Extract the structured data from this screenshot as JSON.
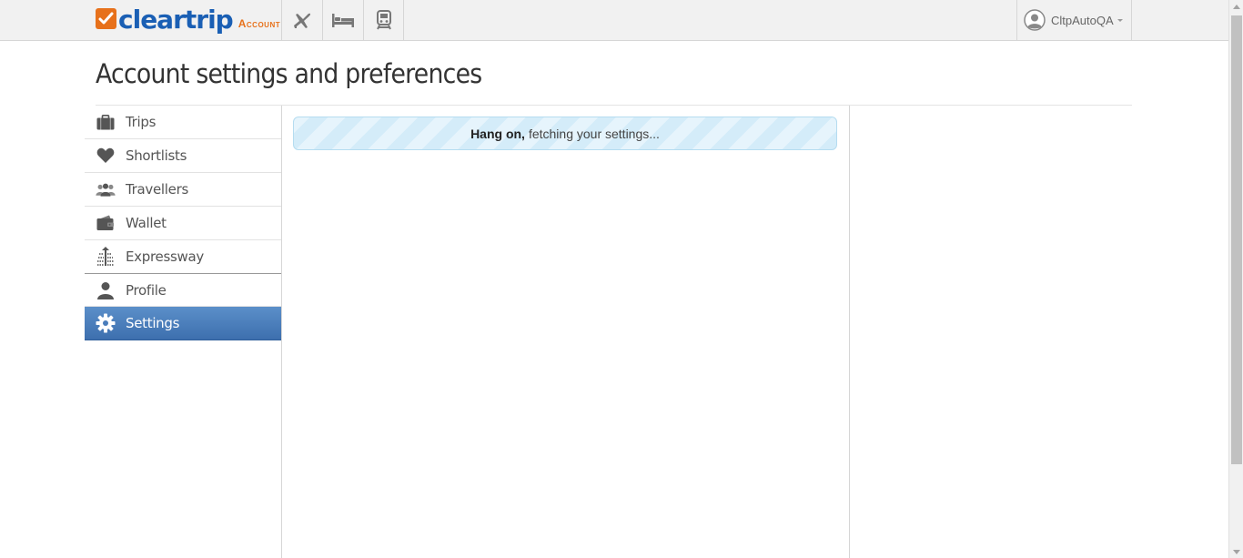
{
  "header": {
    "brand": "cleartrip",
    "brand_sub": "Account",
    "nav": [
      {
        "icon": "airplane-icon"
      },
      {
        "icon": "bed-icon"
      },
      {
        "icon": "train-icon"
      }
    ],
    "user_name": "CltpAutoQA"
  },
  "page": {
    "title": "Account settings and preferences"
  },
  "sidebar": {
    "items": [
      {
        "label": "Trips",
        "icon": "briefcase-icon"
      },
      {
        "label": "Shortlists",
        "icon": "heart-icon"
      },
      {
        "label": "Travellers",
        "icon": "people-icon"
      },
      {
        "label": "Wallet",
        "icon": "wallet-icon"
      },
      {
        "label": "Expressway",
        "icon": "expressway-icon"
      },
      {
        "label": "Profile",
        "icon": "person-icon"
      },
      {
        "label": "Settings",
        "icon": "gear-icon",
        "active": true
      }
    ]
  },
  "main": {
    "loading_bold": "Hang on,",
    "loading_text": "fetching your settings..."
  },
  "colors": {
    "brand_blue": "#1a5fb4",
    "brand_orange": "#e7711b",
    "active_item": "#4a7dbb"
  }
}
